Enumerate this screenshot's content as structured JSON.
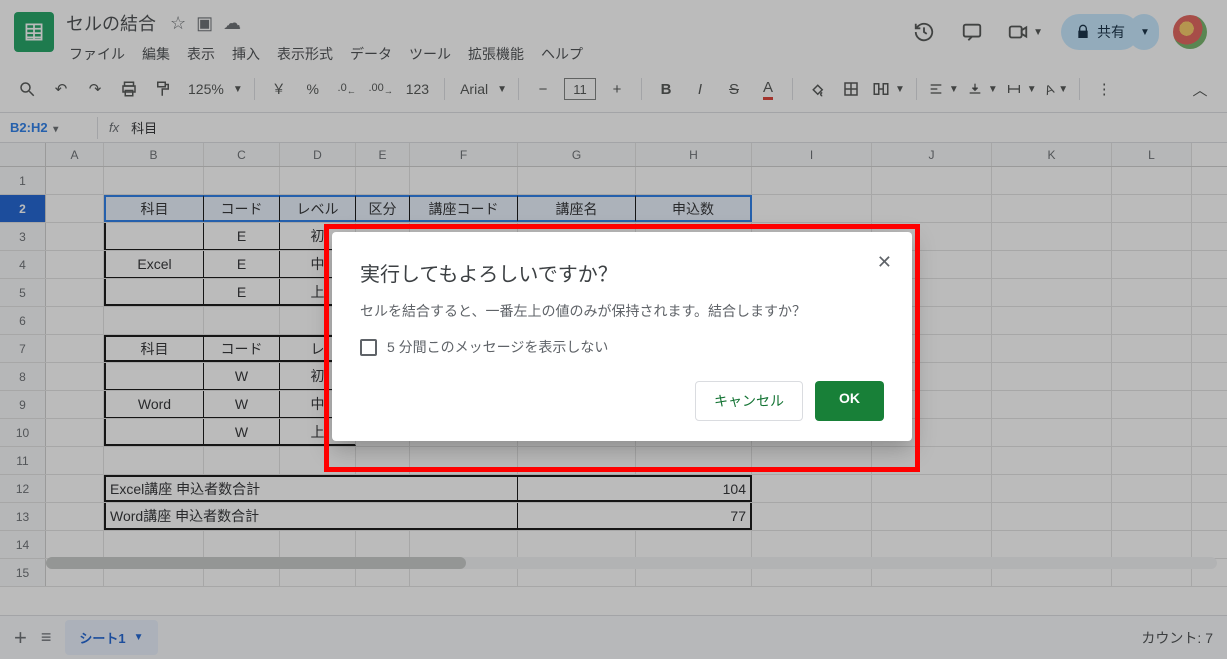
{
  "doc": {
    "title": "セルの結合"
  },
  "menus": [
    "ファイル",
    "編集",
    "表示",
    "挿入",
    "表示形式",
    "データ",
    "ツール",
    "拡張機能",
    "ヘルプ"
  ],
  "share": {
    "label": "共有"
  },
  "toolbar": {
    "zoom": "125%",
    "font": "Arial",
    "fontsize": "11",
    "currency": "￥",
    "percent": "%",
    "decDec": ".0",
    "incDec": ".00",
    "numfmt": "123",
    "plus": "+",
    "minus": "−"
  },
  "namebox": "B2:H2",
  "formula": "科目",
  "columns": [
    "A",
    "B",
    "C",
    "D",
    "E",
    "F",
    "G",
    "H",
    "I",
    "J",
    "K",
    "L"
  ],
  "rows": [
    "1",
    "2",
    "3",
    "4",
    "5",
    "6",
    "7",
    "8",
    "9",
    "10",
    "11",
    "12",
    "13",
    "14",
    "15"
  ],
  "data": {
    "hdr1": [
      "科目",
      "コード",
      "レベル",
      "区分",
      "講座コード",
      "講座名",
      "申込数"
    ],
    "r3": [
      "",
      "E",
      "初"
    ],
    "r4": [
      "Excel",
      "E",
      "中"
    ],
    "r5": [
      "",
      "E",
      "上"
    ],
    "hdr2": [
      "科目",
      "コード",
      "レ"
    ],
    "r8": [
      "",
      "W",
      "初"
    ],
    "r9": [
      "Word",
      "W",
      "中"
    ],
    "r10": [
      "",
      "W",
      "上"
    ],
    "r12label": "Excel講座 申込者数合計",
    "r12val": "104",
    "r13label": "Word講座 申込者数合計",
    "r13val": "77"
  },
  "dialog": {
    "title": "実行してもよろしいですか？",
    "body": "セルを結合すると、一番左上の値のみが保持されます。結合しますか？",
    "checkbox": "5 分間このメッセージを表示しない",
    "cancel": "キャンセル",
    "ok": "OK"
  },
  "tabs": {
    "sheet1": "シート1"
  },
  "status": "カウント: 7"
}
